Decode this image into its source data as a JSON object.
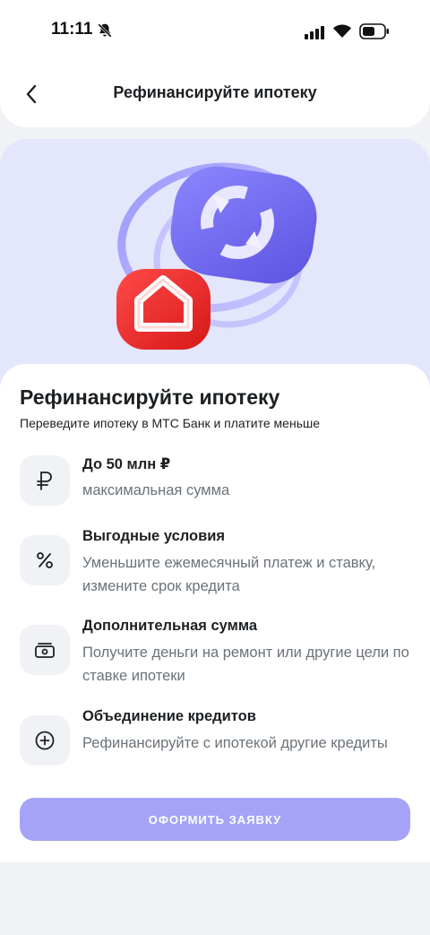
{
  "status_bar": {
    "time": "11:11",
    "icons": [
      "bell-off-icon",
      "signal-icon",
      "wifi-icon",
      "battery-icon"
    ]
  },
  "header": {
    "back_icon": "chevron-left-icon",
    "title": "Рефинансируйте ипотеку"
  },
  "hero": {
    "illustration": "refinance-house-icon",
    "colors": {
      "background": "#e4e6fb",
      "house_tile": "#ee2a2a",
      "refresh_tile": "#6b63e6"
    }
  },
  "main": {
    "title": "Рефинансируйте ипотеку",
    "subtitle": "Переведите ипотеку в МТС Банк и платите меньше",
    "features": [
      {
        "icon": "ruble-icon",
        "title": "До 50 млн ₽",
        "description": "максимальная сумма"
      },
      {
        "icon": "percent-icon",
        "title": "Выгодные условия",
        "description": "Уменьшите ежемесячный платеж и ставку, измените срок кредита"
      },
      {
        "icon": "cash-icon",
        "title": "Дополнительная сумма",
        "description": "Получите деньги на ремонт или другие цели по ставке ипотеки"
      },
      {
        "icon": "plus-circle-icon",
        "title": "Объединение кредитов",
        "description": "Рефинансируйте с ипотекой другие кредиты"
      }
    ]
  },
  "cta": {
    "label": "ОФОРМИТЬ ЗАЯВКУ",
    "color": "#a5a3f7"
  }
}
